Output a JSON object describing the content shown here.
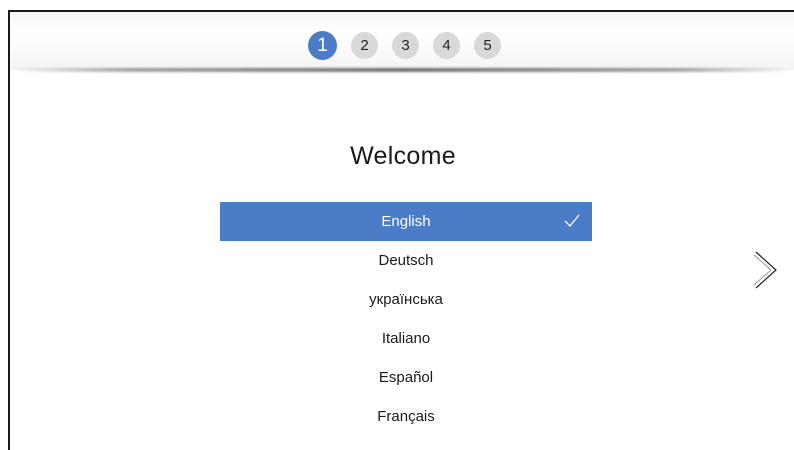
{
  "stepper": {
    "steps": [
      "1",
      "2",
      "3",
      "4",
      "5"
    ],
    "active_index": 0
  },
  "main": {
    "title": "Welcome",
    "languages": [
      {
        "label": "English",
        "selected": true
      },
      {
        "label": "Deutsch",
        "selected": false
      },
      {
        "label": "українська",
        "selected": false
      },
      {
        "label": "Italiano",
        "selected": false
      },
      {
        "label": "Español",
        "selected": false
      },
      {
        "label": "Français",
        "selected": false
      }
    ]
  },
  "icons": {
    "check": "check-icon",
    "next": "chevron-double-right-icon"
  },
  "colors": {
    "accent": "#4a7cc7",
    "step_inactive": "#d9d9d9"
  }
}
